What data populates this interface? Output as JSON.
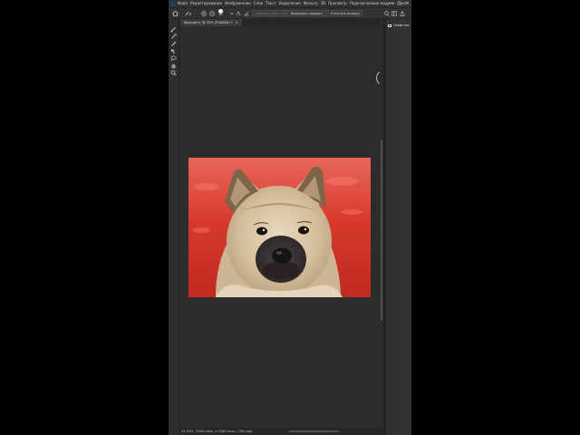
{
  "menubar": {
    "items": [
      "Файл",
      "Редактирование",
      "Изображение",
      "Слои",
      "Текст",
      "Выделение",
      "Фильтр",
      "3D",
      "Просмотр",
      "Подключаемые модули",
      "Окно"
    ],
    "window_controls": [
      "—",
      "□",
      "✕"
    ]
  },
  "options_bar": {
    "brush_size": "50",
    "sample_all_layers": "Образец всех слоев",
    "select_subject": "Выделить предмет",
    "refine_hair": "Уточнить волосы"
  },
  "document": {
    "tab_title": "Фрагмент @ 33% (RGB/8#) *",
    "zoom": "33,33%",
    "size_info": "2560 пикс. x 1965 пикс. (300 ppi)"
  },
  "panel": {
    "title": "Свойства"
  },
  "colors": {
    "image_bg": "#d4362b",
    "workspace": "#2c2c2c",
    "chrome": "#323232"
  }
}
